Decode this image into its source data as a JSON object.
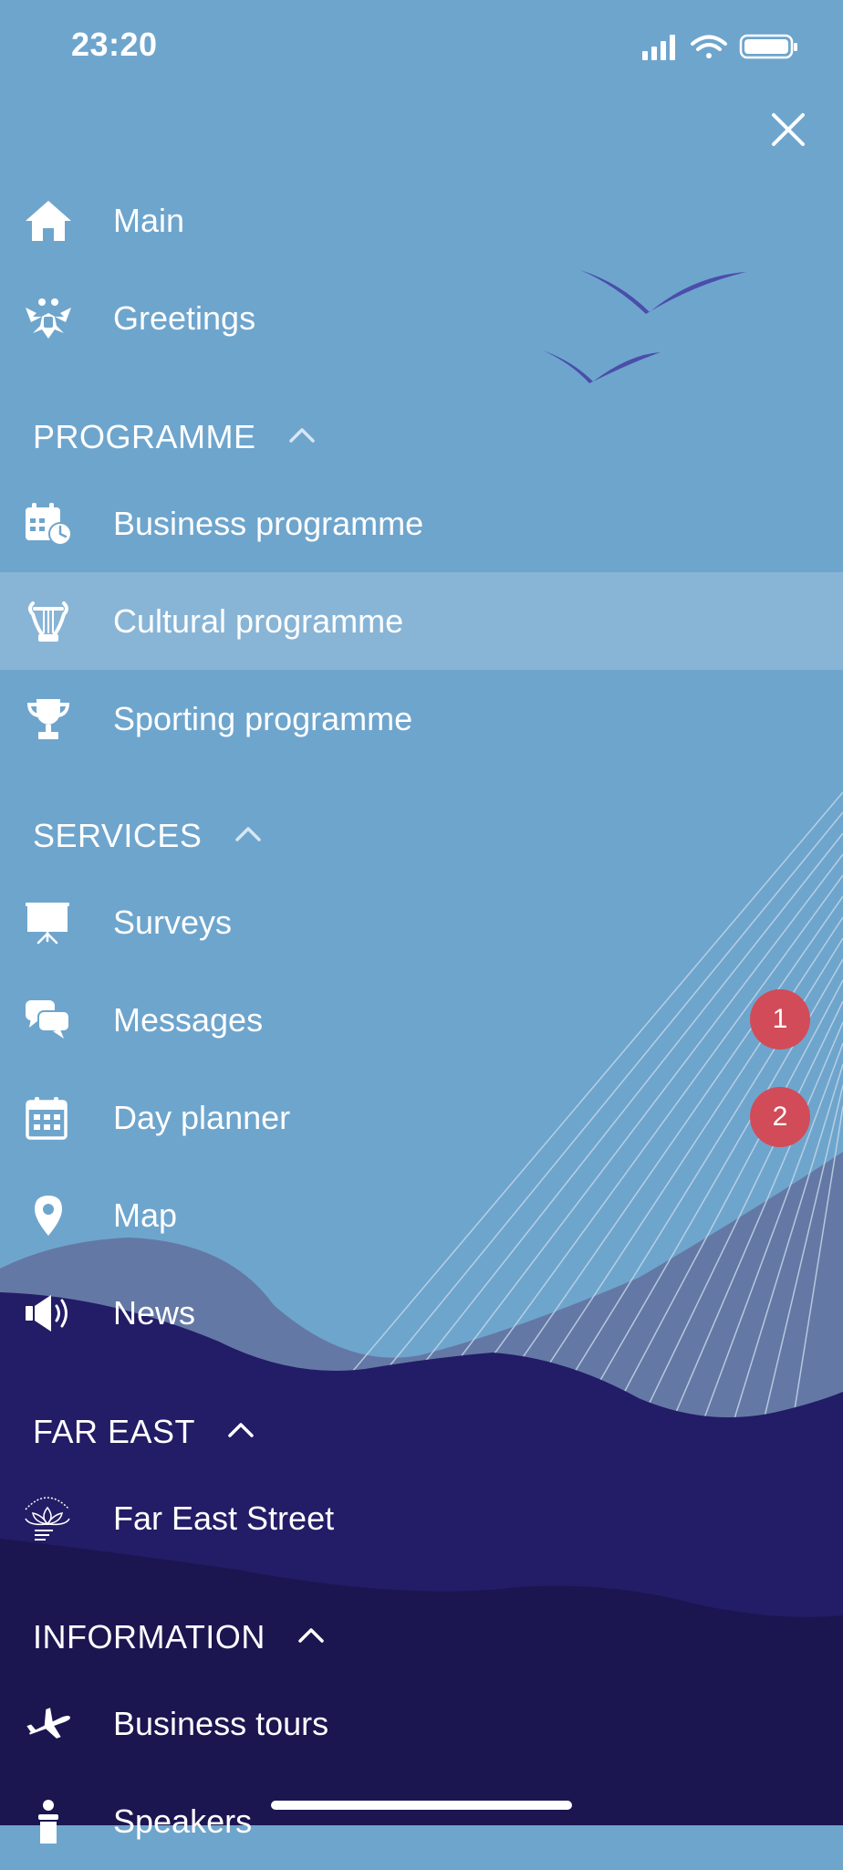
{
  "status_bar": {
    "time": "23:20"
  },
  "menu": {
    "top_items": [
      {
        "label": "Main",
        "icon": "home-icon"
      },
      {
        "label": "Greetings",
        "icon": "eagle-emblem-icon"
      }
    ],
    "sections": [
      {
        "title": "PROGRAMME",
        "expanded": true,
        "items": [
          {
            "label": "Business programme",
            "icon": "calendar-clock-icon"
          },
          {
            "label": "Cultural programme",
            "icon": "lyre-icon",
            "active": true
          },
          {
            "label": "Sporting programme",
            "icon": "trophy-icon"
          }
        ]
      },
      {
        "title": "SERVICES",
        "expanded": true,
        "items": [
          {
            "label": "Surveys",
            "icon": "presentation-board-icon"
          },
          {
            "label": "Messages",
            "icon": "chat-bubbles-icon",
            "badge": "1"
          },
          {
            "label": "Day planner",
            "icon": "calendar-icon",
            "badge": "2"
          },
          {
            "label": "Map",
            "icon": "map-pin-icon"
          },
          {
            "label": "News",
            "icon": "megaphone-icon"
          }
        ]
      },
      {
        "title": "FAR EAST",
        "expanded": true,
        "items": [
          {
            "label": "Far East Street",
            "icon": "far-east-street-logo"
          }
        ]
      },
      {
        "title": "INFORMATION",
        "expanded": true,
        "items": [
          {
            "label": "Business tours",
            "icon": "airplane-icon"
          },
          {
            "label": "Speakers",
            "icon": "speaker-podium-icon"
          }
        ]
      }
    ]
  },
  "colors": {
    "sky": "#6ea5cd",
    "active_row": "#8bb7d8",
    "badge": "#d24b58",
    "hill_light": "#6478a5",
    "hill_dark": "#231c66",
    "bottom": "#1b1550",
    "bird": "#4a4eaa"
  }
}
